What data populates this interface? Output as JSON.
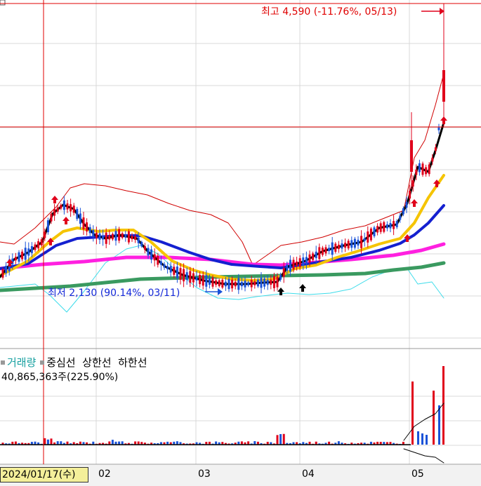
{
  "legend": {
    "volume": "거래량",
    "center": "중심선",
    "upper": "상한선",
    "lower": "하한선"
  },
  "volume_text": "40,865,363주(225.90%)",
  "annotations": {
    "peak": "최고 4,590 (-11.76%, 05/13)",
    "low": "최저 2,130 (90.14%, 03/11)"
  },
  "cursor_date": "2024/01/17(수)",
  "colors": {
    "up": "#e0001b",
    "down": "#1a52d8",
    "ma_black": "#000000",
    "ma_yellow": "#f5c400",
    "ma_blue": "#1420d0",
    "ma_magenta": "#ff20e0",
    "ma_green": "#3a9a60",
    "band_upper": "#d00000",
    "band_lower": "#3cdcea",
    "crosshair": "#e00000"
  },
  "chart_data": {
    "type": "candlestick",
    "x_ticks": [
      "02",
      "03",
      "04",
      "05"
    ],
    "peak": {
      "label": "최고 4,590 (-11.76%, 05/13)",
      "value": 4590,
      "date": "05/13"
    },
    "low": {
      "label": "최저 2,130 (90.14%, 03/11)",
      "value": 2130,
      "date": "03/11"
    },
    "series": [
      {
        "name": "거래량",
        "role": "volume"
      },
      {
        "name": "중심선",
        "role": "bollinger-center"
      },
      {
        "name": "상한선",
        "role": "bollinger-upper"
      },
      {
        "name": "하한선",
        "role": "bollinger-lower"
      }
    ],
    "price_range": [
      1800,
      4700
    ],
    "volume_units": "주",
    "last_volume": 40865363,
    "last_volume_ratio_pct": 225.9
  }
}
